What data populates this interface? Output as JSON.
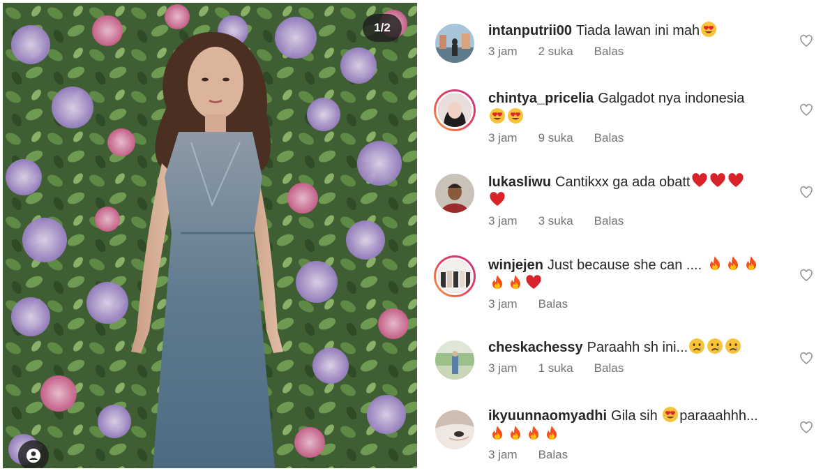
{
  "photo": {
    "counter": "1/2",
    "tag_icon": "person-tag-icon"
  },
  "comments": [
    {
      "username": "intanputrii00",
      "text": "Tiada lawan ini mah",
      "emojis": [
        "heart-eyes"
      ],
      "time": "3 jam",
      "likes": "2 suka",
      "reply": "Balas",
      "story_ring": false
    },
    {
      "username": "chintya_pricelia",
      "text": "Galgadot nya indonesia",
      "emojis": [
        "heart-eyes",
        "heart-eyes"
      ],
      "time": "3 jam",
      "likes": "9 suka",
      "reply": "Balas",
      "story_ring": true
    },
    {
      "username": "lukasliwu",
      "text": "Cantikxx ga ada obatt",
      "emojis": [
        "red-heart",
        "red-heart",
        "red-heart",
        "red-heart"
      ],
      "time": "3 jam",
      "likes": "3 suka",
      "reply": "Balas",
      "story_ring": false
    },
    {
      "username": "winjejen",
      "text": "Just because she can ....",
      "emojis": [
        "fire",
        "fire",
        "fire",
        "fire",
        "fire",
        "red-heart"
      ],
      "time": "3 jam",
      "likes": "",
      "reply": "Balas",
      "story_ring": true
    },
    {
      "username": "cheskachessy",
      "text": "Paraahh sh ini...",
      "emojis": [
        "sad-face",
        "sad-face",
        "sad-face"
      ],
      "time": "3 jam",
      "likes": "1 suka",
      "reply": "Balas",
      "story_ring": false
    },
    {
      "username": "ikyuunnaomyadhi",
      "text": "Gila sih",
      "text2": "paraaahhh...",
      "emojis": [
        "heart-eyes",
        "fire",
        "fire",
        "fire",
        "fire"
      ],
      "time": "3 jam",
      "likes": "",
      "reply": "Balas",
      "story_ring": false
    }
  ],
  "colors": {
    "meta": "#737373",
    "ring_start": "#f9a23a",
    "ring_end": "#c13584"
  }
}
